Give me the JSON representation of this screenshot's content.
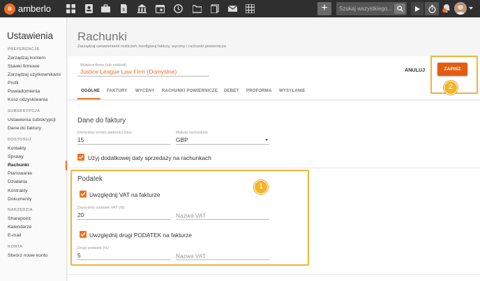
{
  "app": {
    "brand": "amberlo",
    "colors": {
      "accent": "#f36f21",
      "topbar": "#2f2f2f",
      "callout": "#f0b33a"
    }
  },
  "topbar": {
    "icons": [
      "grid-icon",
      "contacts-icon",
      "briefcase-icon",
      "document-icon",
      "bank-icon",
      "calendar-icon",
      "clock-icon",
      "folder-icon",
      "docs-icon",
      "mail-icon",
      "table-icon"
    ],
    "add_label": "+",
    "search_placeholder": "Szukaj wszystkiego..."
  },
  "sidebar": {
    "title": "Ustawienia",
    "sections": [
      {
        "label": "PREFERENCJE",
        "items": [
          "Zarządzaj kontem",
          "Stawki firmowe",
          "Zarządzaj użytkownikami",
          "Profil",
          "Powiadomienia",
          "Kosz odzyskiwania"
        ]
      },
      {
        "label": "SUBSKRYPCJA",
        "items": [
          "Ustawienia subskrypcji",
          "Dane do faktury"
        ]
      },
      {
        "label": "DOSTOSUJ",
        "items": [
          "Kontakty",
          "Sprawy",
          "Rachunki",
          "Planowanie",
          "Działania",
          "Kontrakty",
          "Dokumenty"
        ]
      },
      {
        "label": "NARZĘDZIA",
        "items": [
          "Sharepoint",
          "Kalendarze",
          "E-mail"
        ]
      },
      {
        "label": "KONTA",
        "items": [
          "Stwórz nowe konto"
        ]
      }
    ],
    "active_item": "Rachunki"
  },
  "page": {
    "title": "Rachunki",
    "subtitle": "Zarządzaj ustawieniami rozliczeń, konfiguruj faktury, wyceny i rachunki powiernicze"
  },
  "firm": {
    "label": "Wybierz firmę (lub oddział)",
    "value": "Justice League Law Firm (Domyślne)"
  },
  "actions": {
    "cancel": "ANULUJ",
    "save": "ZAPISZ"
  },
  "tabs": [
    {
      "label": "OGÓLNE",
      "active": true
    },
    {
      "label": "FAKTURY",
      "active": false
    },
    {
      "label": "WYCENY",
      "active": false
    },
    {
      "label": "RACHUNKI POWIERNICZE",
      "active": false
    },
    {
      "label": "DEBET",
      "active": false
    },
    {
      "label": "PROFORMA",
      "active": false
    },
    {
      "label": "WYSYŁANIE",
      "active": false
    }
  ],
  "invoice_data": {
    "title": "Dane do faktury",
    "payment_term_label": "Domyślny termin płatności (dni)",
    "payment_term_value": "15",
    "currency_label": "Waluta rachunków",
    "currency_value": "GBP",
    "sale_date_checkbox": "Użyj dodatkowej daty sprzedaży na rachunkach",
    "sale_date_checked": true
  },
  "tax": {
    "title": "Podatek",
    "vat_checkbox": "Uwzględnij VAT na fakturze",
    "vat_checked": true,
    "vat_rate_label": "Domyślny podatek VAT (%)",
    "vat_rate_value": "20",
    "vat_name_placeholder": "Nazwa VAT",
    "second_tax_checkbox": "Uwzględnij drugi PODATEK na fakturze",
    "second_tax_checked": true,
    "second_tax_label": "Drugi podatek (%)",
    "second_tax_value": "5",
    "second_tax_name_placeholder": "Nazwa VAT"
  },
  "callouts": {
    "one": "1",
    "two": "2"
  }
}
